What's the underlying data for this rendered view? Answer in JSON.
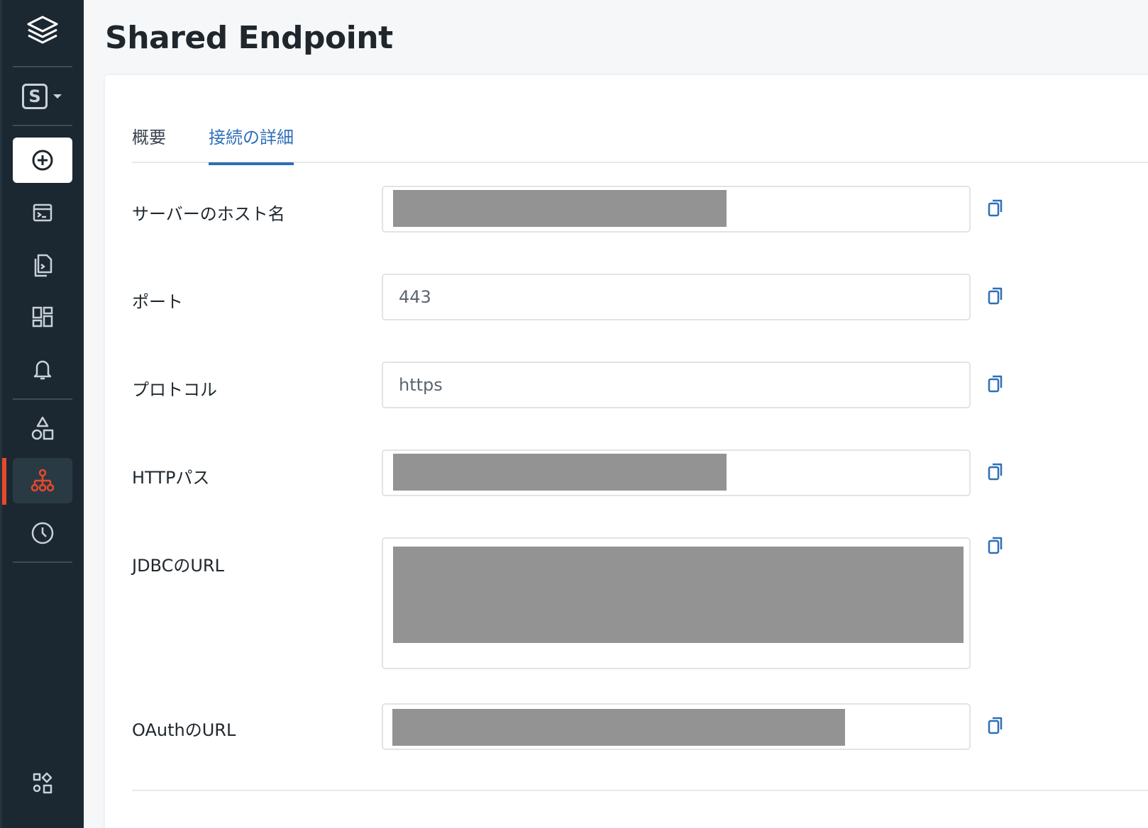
{
  "page_title": "Shared Endpoint",
  "tabs": [
    {
      "label": "概要",
      "active": false
    },
    {
      "label": "接続の詳細",
      "active": true
    }
  ],
  "fields": {
    "hostname": {
      "label": "サーバーのホスト名",
      "value": "",
      "redacted": true
    },
    "port": {
      "label": "ポート",
      "value": "443"
    },
    "protocol": {
      "label": "プロトコル",
      "value": "https"
    },
    "http_path": {
      "label": "HTTPパス",
      "value": "",
      "redacted": true
    },
    "jdbc_url": {
      "label": "JDBCのURL",
      "value": "",
      "redacted": true
    },
    "oauth_url": {
      "label": "OAuthのURL",
      "value": "",
      "redacted": true
    }
  },
  "sidebar": {
    "workspace_letter": "S",
    "items": [
      {
        "icon": "layers-logo-icon"
      },
      {
        "icon": "workspace-switcher-icon"
      },
      {
        "icon": "plus-circle-icon"
      },
      {
        "icon": "sql-editor-icon"
      },
      {
        "icon": "queries-icon"
      },
      {
        "icon": "dashboards-icon"
      },
      {
        "icon": "alerts-bell-icon"
      },
      {
        "icon": "data-shapes-icon"
      },
      {
        "icon": "endpoints-icon",
        "active": true
      },
      {
        "icon": "history-clock-icon"
      },
      {
        "icon": "settings-shapes-icon"
      }
    ]
  },
  "colors": {
    "sidebar_bg": "#1b2832",
    "accent_blue": "#2e6fb8",
    "active_orange": "#e8492b",
    "redaction_gray": "#939393"
  }
}
